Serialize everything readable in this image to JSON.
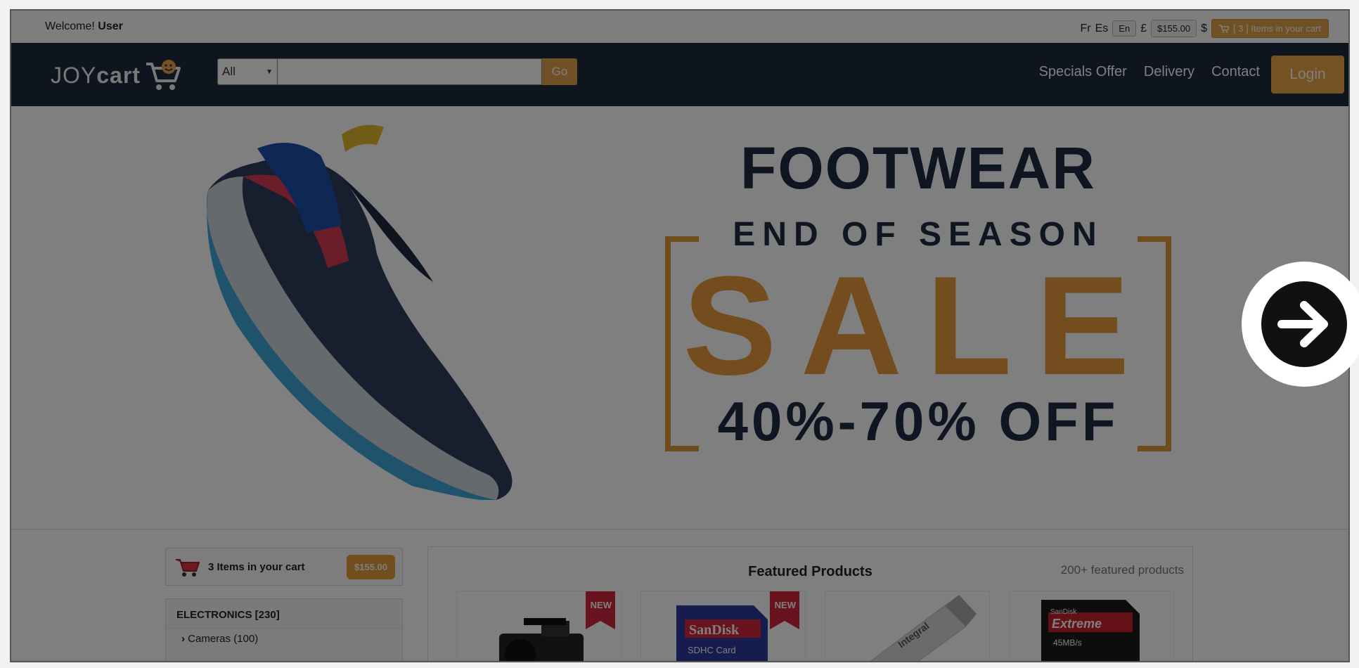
{
  "topbar": {
    "welcome_prefix": "Welcome!",
    "welcome_user": "User",
    "languages": [
      "Fr",
      "Es",
      "En"
    ],
    "currency_gbp": "£",
    "cart_total": "$155.00",
    "currency_usd": "$",
    "cart_button": "[ 3 ] Items in your cart"
  },
  "header": {
    "logo_light": "JOY",
    "logo_bold": "cart",
    "search_category": "All",
    "search_button": "Go",
    "nav": [
      "Specials Offer",
      "Delivery",
      "Contact"
    ],
    "login": "Login"
  },
  "banner": {
    "heading": "FOOTWEAR",
    "subheading": "END OF SEASON",
    "sale": "SALE",
    "discount": "40%-70% OFF"
  },
  "sidebar": {
    "cart_summary": "3 Items in your cart",
    "cart_amount": "$155.00",
    "category_title": "ELECTRONICS [230]",
    "category_items": [
      "Cameras (100)"
    ]
  },
  "featured": {
    "title": "Featured Products",
    "count": "200+ featured products",
    "products": [
      {
        "badge": "NEW"
      },
      {
        "badge": "NEW",
        "brand": "SanDisk",
        "label": "SDHC Card"
      },
      {
        "brand": "Integral"
      },
      {
        "brand": "SanDisk",
        "label": "Extreme",
        "speed": "45MB/s"
      }
    ]
  },
  "colors": {
    "header_bg": "#1c2a3f",
    "accent": "#e0a04a",
    "overlay": "rgba(0,0,0,0.5)"
  }
}
